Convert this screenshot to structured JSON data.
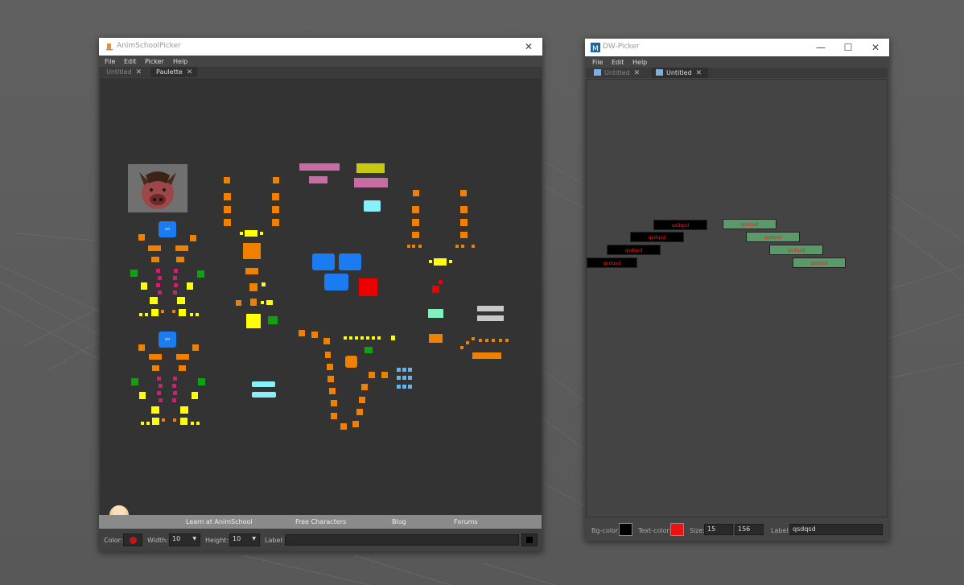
{
  "anim": {
    "title": "AnimSchoolPicker",
    "menu": [
      "File",
      "Edit",
      "Picker",
      "Help"
    ],
    "tabs": [
      {
        "label": "Untitled"
      },
      {
        "label": "Paulette"
      }
    ],
    "footer_links": [
      "Learn at AnimSchool",
      "Free Characters",
      "Blog",
      "Forums"
    ],
    "toolbar": {
      "color_label": "Color:",
      "color_value": "#c01818",
      "width_label": "Width:",
      "width_value": "10",
      "height_label": "Height:",
      "height_value": "10",
      "label_label": "Label:",
      "label_value": ""
    }
  },
  "dw": {
    "title": "DW-Picker",
    "menu": [
      "File",
      "Edit",
      "Help"
    ],
    "tabs": [
      {
        "label": "Untitled"
      },
      {
        "label": "Untitled"
      }
    ],
    "buttons": [
      "qsdqsd",
      "qsdqsd",
      "qsdqsd",
      "qsdqsd",
      "qsdqsd",
      "qsdqsd",
      "qsdqsd",
      "qsdqsd"
    ],
    "toolbar": {
      "bg_label": "Bg-color:",
      "bg_color": "#000000",
      "text_label": "Text-color:",
      "text_color": "#ee1111",
      "size_label": "Size:",
      "size_w": "15",
      "size_h": "156",
      "label_label": "Label:",
      "label_value": "qsdqsd"
    }
  },
  "colors": {
    "orange": "#f08000",
    "yellow": "#ffff00",
    "green": "#12a012",
    "magenta": "#cc2070",
    "blue": "#1a7cf0",
    "red": "#ee0000",
    "cyan": "#88f0f8"
  }
}
